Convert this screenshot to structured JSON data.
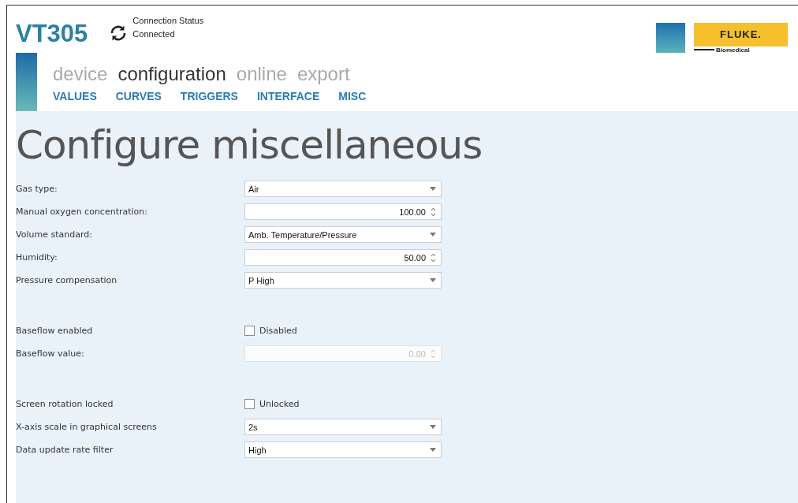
{
  "app": {
    "title": "VT305"
  },
  "connection": {
    "label": "Connection Status",
    "status": "Connected"
  },
  "logo": {
    "brand": "FLUKE.",
    "subtitle": "Biomedical"
  },
  "tabs": [
    {
      "label": "device",
      "selected": false
    },
    {
      "label": "configuration",
      "selected": true
    },
    {
      "label": "online",
      "selected": false
    },
    {
      "label": "export",
      "selected": false
    }
  ],
  "subtabs": [
    "VALUES",
    "CURVES",
    "TRIGGERS",
    "INTERFACE",
    "MISC"
  ],
  "page_title": "Configure miscellaneous",
  "groups": [
    [
      {
        "label": "Gas type:",
        "kind": "select",
        "value": "Air",
        "disabled": false
      },
      {
        "label": "Manual oxygen concentration:",
        "kind": "spin",
        "value": "100.00",
        "disabled": false
      },
      {
        "label": "Volume standard:",
        "kind": "select",
        "value": "Amb. Temperature/Pressure",
        "disabled": false
      },
      {
        "label": "Humidity:",
        "kind": "spin",
        "value": "50.00",
        "disabled": false
      },
      {
        "label": "Pressure compensation",
        "kind": "select",
        "value": "P High",
        "disabled": false
      }
    ],
    [
      {
        "label": "Baseflow enabled",
        "kind": "checkbox",
        "value": "Disabled",
        "checked": false
      },
      {
        "label": "Baseflow value:",
        "kind": "spin",
        "value": "0.00",
        "disabled": true
      }
    ],
    [
      {
        "label": "Screen rotation locked",
        "kind": "checkbox",
        "value": "Unlocked",
        "checked": false
      },
      {
        "label": "X-axis scale in graphical screens",
        "kind": "select",
        "value": "2s",
        "disabled": false
      },
      {
        "label": "Data update rate filter",
        "kind": "select",
        "value": "High",
        "disabled": false
      }
    ]
  ]
}
